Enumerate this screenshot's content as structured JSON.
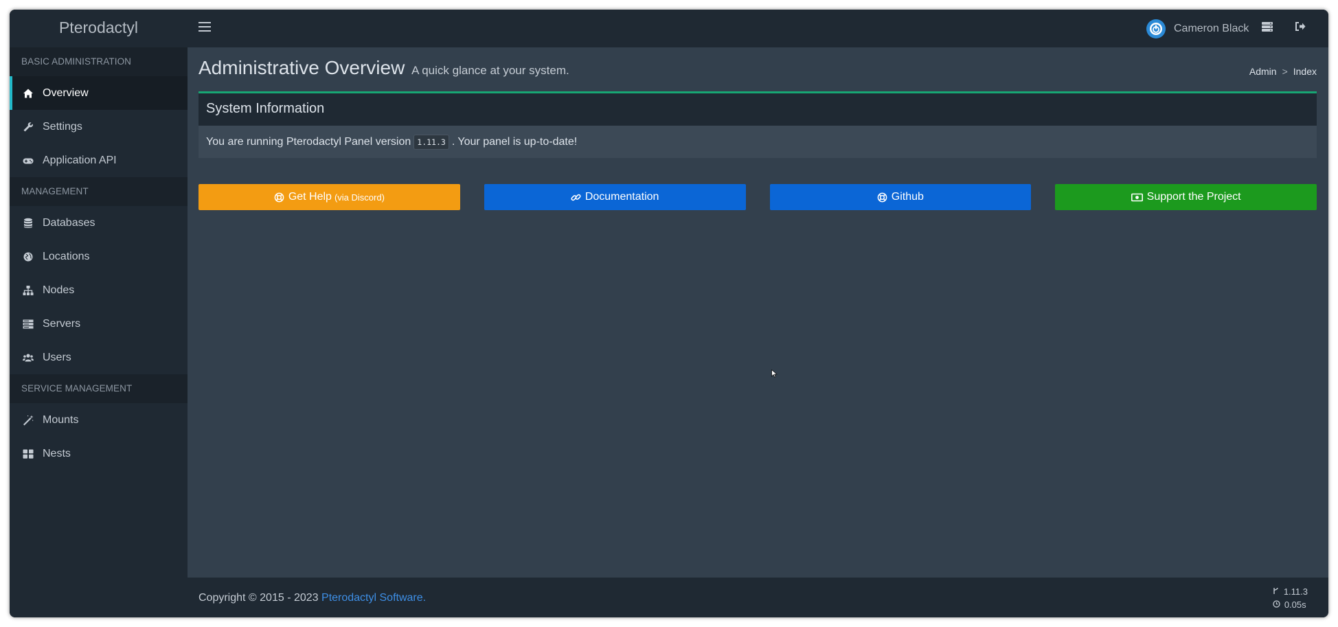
{
  "app": {
    "brand": "Pterodactyl"
  },
  "header": {
    "user_name": "Cameron Black",
    "icons": [
      "power-icon",
      "menu-icon",
      "servers-icon",
      "logout-icon"
    ]
  },
  "sidebar": {
    "sections": [
      {
        "title": "BASIC ADMINISTRATION",
        "items": [
          {
            "label": "Overview",
            "icon": "home-icon",
            "active": true
          },
          {
            "label": "Settings",
            "icon": "wrench-icon"
          },
          {
            "label": "Application API",
            "icon": "gamepad-icon"
          }
        ]
      },
      {
        "title": "MANAGEMENT",
        "items": [
          {
            "label": "Databases",
            "icon": "database-icon"
          },
          {
            "label": "Locations",
            "icon": "globe-icon"
          },
          {
            "label": "Nodes",
            "icon": "sitemap-icon"
          },
          {
            "label": "Servers",
            "icon": "server-icon"
          },
          {
            "label": "Users",
            "icon": "users-icon"
          }
        ]
      },
      {
        "title": "SERVICE MANAGEMENT",
        "items": [
          {
            "label": "Mounts",
            "icon": "magic-icon"
          },
          {
            "label": "Nests",
            "icon": "th-large-icon"
          }
        ]
      }
    ]
  },
  "page": {
    "title": "Administrative Overview",
    "subtitle": "A quick glance at your system.",
    "breadcrumb": [
      "Admin",
      ">",
      "Index"
    ]
  },
  "system_info": {
    "title": "System Information",
    "text_before": "You are running Pterodactyl Panel version",
    "version": "1.11.3",
    "text_after": ". Your panel is up-to-date!"
  },
  "buttons": [
    {
      "label": "Get Help",
      "suffix": "(via Discord)",
      "color": "#f39c12",
      "icon": "life-ring-icon"
    },
    {
      "label": "Documentation",
      "color": "#0b66d6",
      "icon": "link-icon"
    },
    {
      "label": "Github",
      "color": "#0b66d6",
      "icon": "life-ring-icon"
    },
    {
      "label": "Support the Project",
      "color": "#1c9a1e",
      "icon": "money-icon"
    }
  ],
  "footer": {
    "copyright": "Copyright © 2015 - 2023",
    "link": "Pterodactyl Software.",
    "version": "1.11.3",
    "time": "0.05s"
  },
  "colors": {
    "accent_box": "#17a673",
    "link": "#3e8fe6",
    "active_border": "#22b8c8"
  }
}
